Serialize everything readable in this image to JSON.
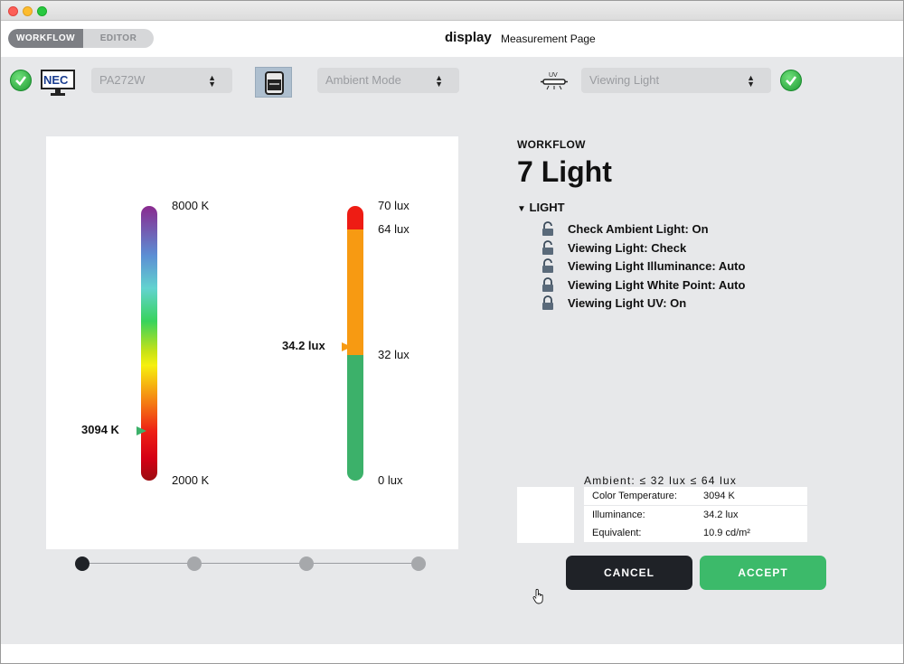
{
  "header": {
    "segments": {
      "workflow": "WORKFLOW",
      "editor": "EDITOR"
    },
    "title": "display",
    "subtitle": "Measurement Page"
  },
  "toolbar": {
    "display_select": "PA272W",
    "ambient_select": "Ambient Mode",
    "viewing_select": "Viewing Light",
    "uv_label": "UV",
    "left_status": "ok",
    "right_status": "ok",
    "icons": [
      "check-icon",
      "nec-monitor-icon",
      "colorimeter-icon",
      "uv-lamp-icon"
    ]
  },
  "gauges": {
    "color_temp": {
      "max_label": "8000 K",
      "min_label": "2000 K",
      "reading": "3094 K",
      "min": 2000,
      "max": 8000,
      "value": 3094
    },
    "illuminance": {
      "top_label": "70 lux",
      "upper_label": "64 lux",
      "lower_label": "32 lux",
      "bottom_label": "0 lux",
      "reading": "34.2 lux",
      "min": 0,
      "max": 70,
      "value": 34.2
    }
  },
  "stepper": {
    "steps": 4,
    "active": 1
  },
  "workflow": {
    "label": "WORKFLOW",
    "title": "7 Light",
    "section": "LIGHT",
    "settings": [
      "Check Ambient Light:   On",
      "Viewing Light:   Check",
      "Viewing Light Illuminance:   Auto",
      "Viewing Light White Point:   Auto",
      "Viewing Light UV:   On"
    ]
  },
  "readout": {
    "ambient": "Ambient: ≤ 32 lux ≤ 64 lux",
    "rows": [
      {
        "key": "Color Temperature:",
        "value": "3094 K"
      },
      {
        "key": "Illuminance:",
        "value": "34.2 lux"
      },
      {
        "key": "Equivalent:",
        "value": "10.9 cd/m²"
      }
    ]
  },
  "buttons": {
    "cancel": "CANCEL",
    "accept": "ACCEPT"
  },
  "colors": {
    "accept": "#3cba6a",
    "cancel": "#1f2227",
    "active_segment": "#7d7f84"
  }
}
